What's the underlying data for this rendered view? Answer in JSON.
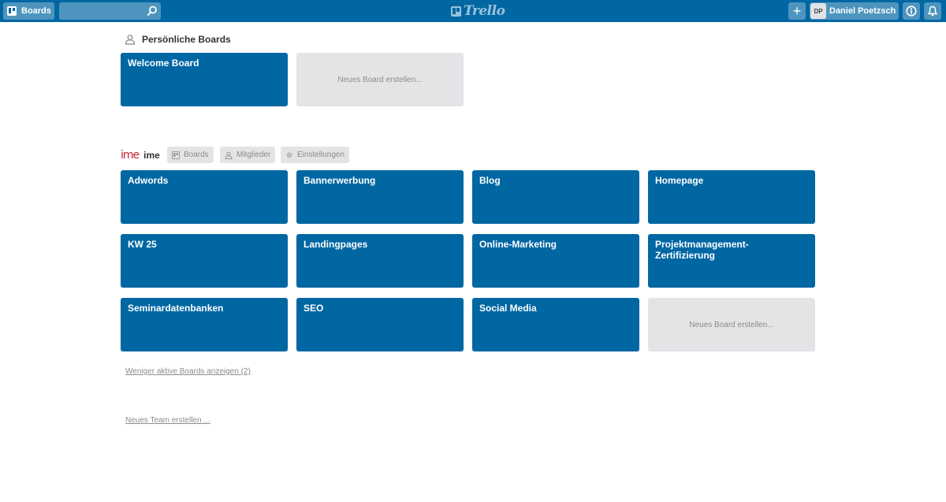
{
  "header": {
    "boards_label": "Boards",
    "search_value": "",
    "logo_text": "Trello",
    "avatar_initials": "DP",
    "user_name": "Daniel Poetzsch",
    "plus_label": "+"
  },
  "personal": {
    "title": "Persönliche Boards",
    "boards": [
      "Welcome Board"
    ],
    "new_board_label": "Neues Board erstellen..."
  },
  "team": {
    "logo_text": "ime",
    "name": "ime",
    "tabs": [
      "Boards",
      "Mitglieder",
      "Einstellungen"
    ],
    "boards": [
      "Adwords",
      "Bannerwerbung",
      "Blog",
      "Homepage",
      "KW 25",
      "Landingpages",
      "Online-Marketing",
      "Projektmanagement-Zertifizierung",
      "Seminardatenbanken",
      "SEO",
      "Social Media"
    ],
    "new_board_label": "Neues Board erstellen..."
  },
  "links": {
    "less_active": "Weniger aktive Boards anzeigen (2)",
    "new_team": "Neues Team erstellen ..."
  },
  "colors": {
    "brand": "#0067a3",
    "tile_new": "#e2e4e6",
    "team_logo": "#c0202a"
  }
}
